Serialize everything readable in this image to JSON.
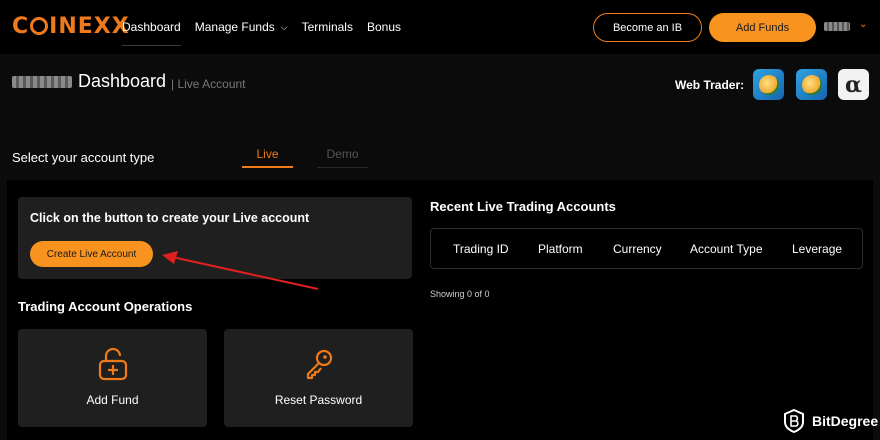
{
  "brand": {
    "logo": "COINEXX",
    "accent": "#f07a1a",
    "button_fill": "#f7931e"
  },
  "nav": {
    "items": [
      {
        "label": "Dashboard",
        "active": true
      },
      {
        "label": "Manage Funds",
        "has_dropdown": true
      },
      {
        "label": "Terminals"
      },
      {
        "label": "Bonus"
      }
    ]
  },
  "header": {
    "become_ib_label": "Become an IB",
    "add_funds_label": "Add Funds"
  },
  "page": {
    "title": "Dashboard",
    "subtitle": "| Live Account",
    "web_trader_label": "Web Trader:",
    "web_trader_icons": [
      "metatrader-4-icon",
      "metatrader-5-icon",
      "alpha-platform-icon"
    ]
  },
  "account_type": {
    "label": "Select your account type",
    "tabs": [
      {
        "label": "Live",
        "active": true
      },
      {
        "label": "Demo",
        "active": false
      }
    ]
  },
  "create_card": {
    "text": "Click on the button to create your Live account",
    "button_label": "Create Live Account"
  },
  "operations": {
    "title": "Trading Account Operations",
    "cards": [
      {
        "label": "Add Fund",
        "icon": "unlock-plus-icon"
      },
      {
        "label": "Reset Password",
        "icon": "key-icon"
      }
    ]
  },
  "recent": {
    "title": "Recent Live Trading Accounts",
    "columns": [
      "Trading ID",
      "Platform",
      "Currency",
      "Account Type",
      "Leverage"
    ],
    "rows": [],
    "showing": "Showing 0 of 0"
  },
  "watermark": {
    "text": "BitDegree"
  }
}
